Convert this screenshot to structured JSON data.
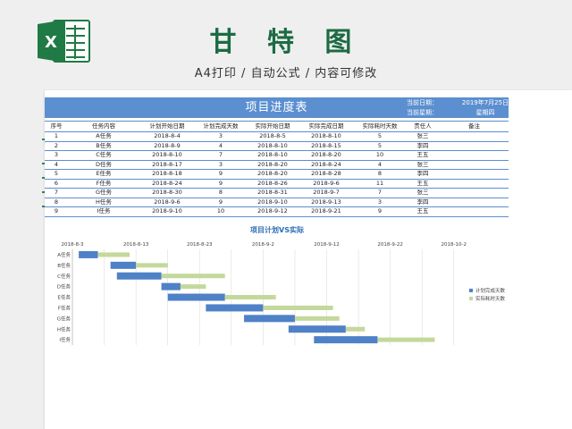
{
  "header": {
    "title": "甘 特 图",
    "subtitle": "A4打印 / 自动公式 / 内容可修改",
    "logo_icon": "excel-logo-icon",
    "accent_color": "#1c6b43"
  },
  "sheet": {
    "banner_title": "项目进度表",
    "current_date_label": "当前日期：",
    "current_date_value": "2019年7月25日",
    "current_weekday_label": "当前星期：",
    "current_weekday_value": "星期四",
    "header_color": "#5b8fd0"
  },
  "table": {
    "columns": [
      "序号",
      "任务内容",
      "计划开始日期",
      "计划完成天数",
      "实际开始日期",
      "实际完成日期",
      "实际耗时天数",
      "责任人",
      "备注"
    ],
    "rows": [
      [
        "1",
        "A任务",
        "2018-8-4",
        "3",
        "2018-8-5",
        "2018-8-10",
        "5",
        "张三",
        ""
      ],
      [
        "2",
        "B任务",
        "2018-8-9",
        "4",
        "2018-8-10",
        "2018-8-15",
        "5",
        "李四",
        ""
      ],
      [
        "3",
        "C任务",
        "2018-8-10",
        "7",
        "2018-8-10",
        "2018-8-20",
        "10",
        "王五",
        ""
      ],
      [
        "4",
        "D任务",
        "2018-8-17",
        "3",
        "2018-8-20",
        "2018-8-24",
        "4",
        "张三",
        ""
      ],
      [
        "5",
        "E任务",
        "2018-8-18",
        "9",
        "2018-8-20",
        "2018-8-28",
        "8",
        "李四",
        ""
      ],
      [
        "6",
        "F任务",
        "2018-8-24",
        "9",
        "2018-8-26",
        "2018-9-6",
        "11",
        "王五",
        ""
      ],
      [
        "7",
        "G任务",
        "2018-8-30",
        "8",
        "2018-8-31",
        "2018-9-7",
        "7",
        "张三",
        ""
      ],
      [
        "8",
        "H任务",
        "2018-9-6",
        "9",
        "2018-9-10",
        "2018-9-13",
        "3",
        "李四",
        ""
      ],
      [
        "9",
        "I任务",
        "2018-9-10",
        "10",
        "2018-9-12",
        "2018-9-21",
        "9",
        "王五",
        ""
      ]
    ]
  },
  "chart_data": {
    "type": "bar",
    "orientation": "horizontal",
    "stacked": true,
    "title": "项目计划VS实际",
    "categories": [
      "A任务",
      "B任务",
      "C任务",
      "D任务",
      "E任务",
      "F任务",
      "G任务",
      "H任务",
      "I任务"
    ],
    "x_ticks": [
      "2018-8-3",
      "2018-8-13",
      "2018-8-23",
      "2018-9-2",
      "2018-9-12",
      "2018-9-22",
      "2018-10-2"
    ],
    "xlim": [
      "2018-8-3",
      "2018-10-4"
    ],
    "start_dates": [
      "2018-8-4",
      "2018-8-9",
      "2018-8-10",
      "2018-8-17",
      "2018-8-18",
      "2018-8-24",
      "2018-8-30",
      "2018-9-6",
      "2018-9-10"
    ],
    "series": [
      {
        "name": "计划完成天数",
        "color": "#4f81c7",
        "values": [
          3,
          4,
          7,
          3,
          9,
          9,
          8,
          9,
          10
        ]
      },
      {
        "name": "实际耗时天数",
        "color": "#c4d89b",
        "values": [
          5,
          5,
          10,
          4,
          8,
          11,
          7,
          3,
          9
        ]
      }
    ],
    "grid": true,
    "legend_position": "right"
  }
}
